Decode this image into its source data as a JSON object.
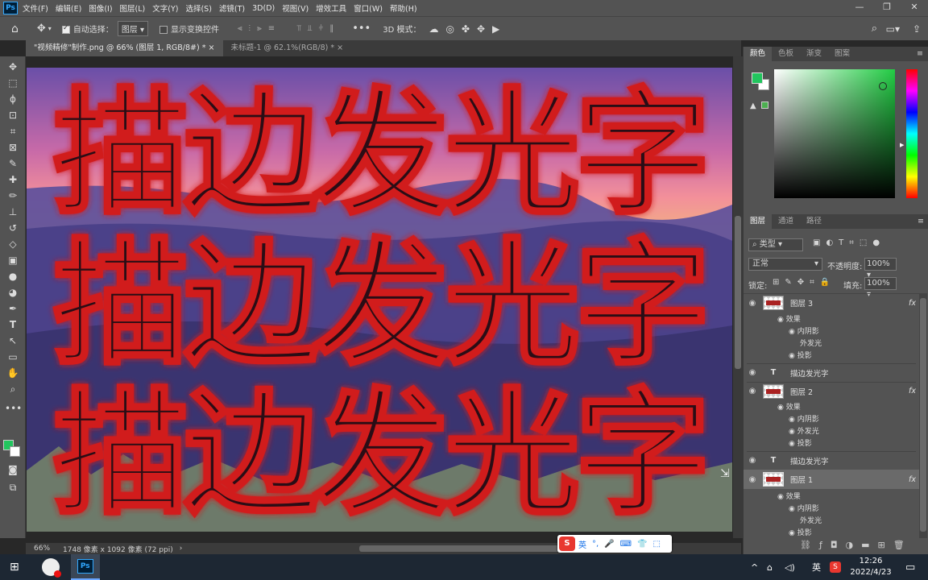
{
  "menubar": {
    "app_icon": "Ps",
    "items": [
      "文件(F)",
      "编辑(E)",
      "图像(I)",
      "图层(L)",
      "文字(Y)",
      "选择(S)",
      "滤镜(T)",
      "3D(D)",
      "视图(V)",
      "增效工具",
      "窗口(W)",
      "帮助(H)"
    ],
    "window_controls": [
      "—",
      "❐",
      "✕"
    ]
  },
  "options": {
    "auto_select_label": "自动选择：",
    "auto_select_value": "图层",
    "show_transform_label": "显示变换控件",
    "mode3d_label": "3D 模式："
  },
  "tabs": [
    {
      "label": "\"视频精修\"制作.png @ 66% (图层 1, RGB/8#) *",
      "close": "×"
    },
    {
      "label": "未标题-1 @ 62.1%(RGB/8) *",
      "close": "×"
    }
  ],
  "canvas": {
    "lines": [
      "描边发光字",
      "描边发光字",
      "描边发光字"
    ]
  },
  "status": {
    "zoom": "66%",
    "doc_info": "1748 像素 x 1092 像素 (72 ppi)",
    "arrow": "›"
  },
  "color_panel": {
    "tabs": [
      "颜色",
      "色板",
      "渐变",
      "图案"
    ],
    "fg_color": "#22c55e",
    "bg_color": "#ffffff",
    "hue_color": "#22cc44"
  },
  "layers_panel": {
    "tabs": [
      "图层",
      "通道",
      "路径"
    ],
    "filter_label": "类型",
    "blend_mode": "正常",
    "opacity_label": "不透明度:",
    "opacity_value": "100%",
    "lock_label": "锁定:",
    "fill_label": "填充:",
    "fill_value": "100%",
    "layers": [
      {
        "name": "图层 3",
        "fx": "fx",
        "effects_label": "效果",
        "effects": [
          "内阴影",
          "外发光",
          "投影"
        ]
      },
      {
        "name": "描边发光字",
        "type": "T"
      },
      {
        "name": "图层 2",
        "fx": "fx",
        "effects_label": "效果",
        "effects": [
          "内阴影",
          "外发光",
          "投影"
        ]
      },
      {
        "name": "描边发光字",
        "type": "T"
      },
      {
        "name": "图层 1",
        "fx": "fx",
        "effects_label": "效果",
        "effects": [
          "内阴影",
          "外发光",
          "投影"
        ]
      }
    ]
  },
  "ime": {
    "logo": "S",
    "lang": "英",
    "items": [
      "°,",
      "🎤",
      "⌨",
      "👕",
      "⬚"
    ]
  },
  "taskbar": {
    "time": "12:26",
    "date": "2022/4/23",
    "lang": "英",
    "tray_arrow": "^",
    "ps_icon": "Ps"
  }
}
